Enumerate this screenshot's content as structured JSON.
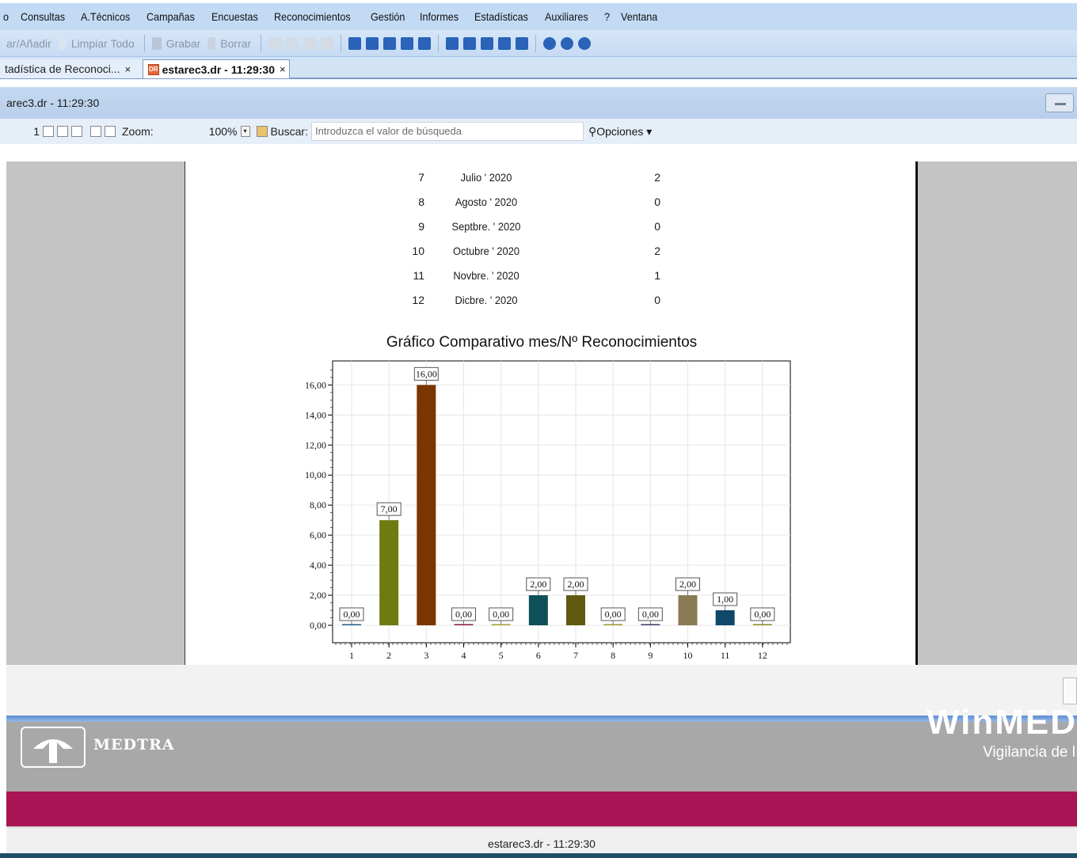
{
  "menu": [
    "o",
    "Consultas",
    "A.Técnicos",
    "Campañas",
    "Encuestas",
    "Reconocimientos",
    "Gestión",
    "Informes",
    "Estadísticas",
    "Auxiliares",
    "?",
    "Ventana"
  ],
  "toolbar": {
    "add_label": "ar/Añadir",
    "clear_label": "Limpiar Todo",
    "save_label": "Grabar",
    "delete_label": "Borrar"
  },
  "tabs": {
    "inactive_label": "tadística de Reconoci...",
    "inactive_close": "×",
    "active_label": "estarec3.dr - 11:29:30",
    "active_close": "×"
  },
  "document_title": "arec3.dr - 11:29:30",
  "viewer": {
    "page_number": "1",
    "zoom_label": "Zoom:",
    "zoom_value": "100%",
    "search_label": "Buscar:",
    "search_placeholder": "Introduzca el valor de búsqueda",
    "options_label": "Opciones"
  },
  "report_rows": [
    {
      "num": "7",
      "month": "Julio ' 2020",
      "count": "2"
    },
    {
      "num": "8",
      "month": "Agosto ' 2020",
      "count": "0"
    },
    {
      "num": "9",
      "month": "Septbre. ' 2020",
      "count": "0"
    },
    {
      "num": "10",
      "month": "Octubre ' 2020",
      "count": "2"
    },
    {
      "num": "11",
      "month": "Novbre. ' 2020",
      "count": "1"
    },
    {
      "num": "12",
      "month": "Dicbre. ' 2020",
      "count": "0"
    }
  ],
  "chart_data": {
    "type": "bar",
    "title": "Gráfico Comparativo mes/Nº Reconocimientos",
    "categories": [
      "1",
      "2",
      "3",
      "4",
      "5",
      "6",
      "7",
      "8",
      "9",
      "10",
      "11",
      "12"
    ],
    "values": [
      0,
      7,
      16,
      0,
      0,
      2,
      2,
      0,
      0,
      2,
      1,
      0
    ],
    "data_labels": [
      "0,00",
      "7,00",
      "16,00",
      "0,00",
      "0,00",
      "2,00",
      "2,00",
      "0,00",
      "0,00",
      "2,00",
      "1,00",
      "0,00"
    ],
    "colors": [
      "#1f5f8b",
      "#6f7a10",
      "#7a3500",
      "#8b1a3a",
      "#a8a030",
      "#0f4f58",
      "#5f5a10",
      "#a09830",
      "#3a3a6a",
      "#8a7a55",
      "#0f4868",
      "#8a8a20"
    ],
    "yticks": [
      "0,00",
      "2,00",
      "4,00",
      "6,00",
      "8,00",
      "10,00",
      "12,00",
      "14,00",
      "16,00"
    ],
    "ylim": [
      0,
      17.6
    ],
    "grid": true
  },
  "brand": {
    "company": "MEDTRA",
    "product": "WinMED",
    "tagline": "Vigilancia de l"
  },
  "status_bar": "estarec3.dr - 11:29:30"
}
